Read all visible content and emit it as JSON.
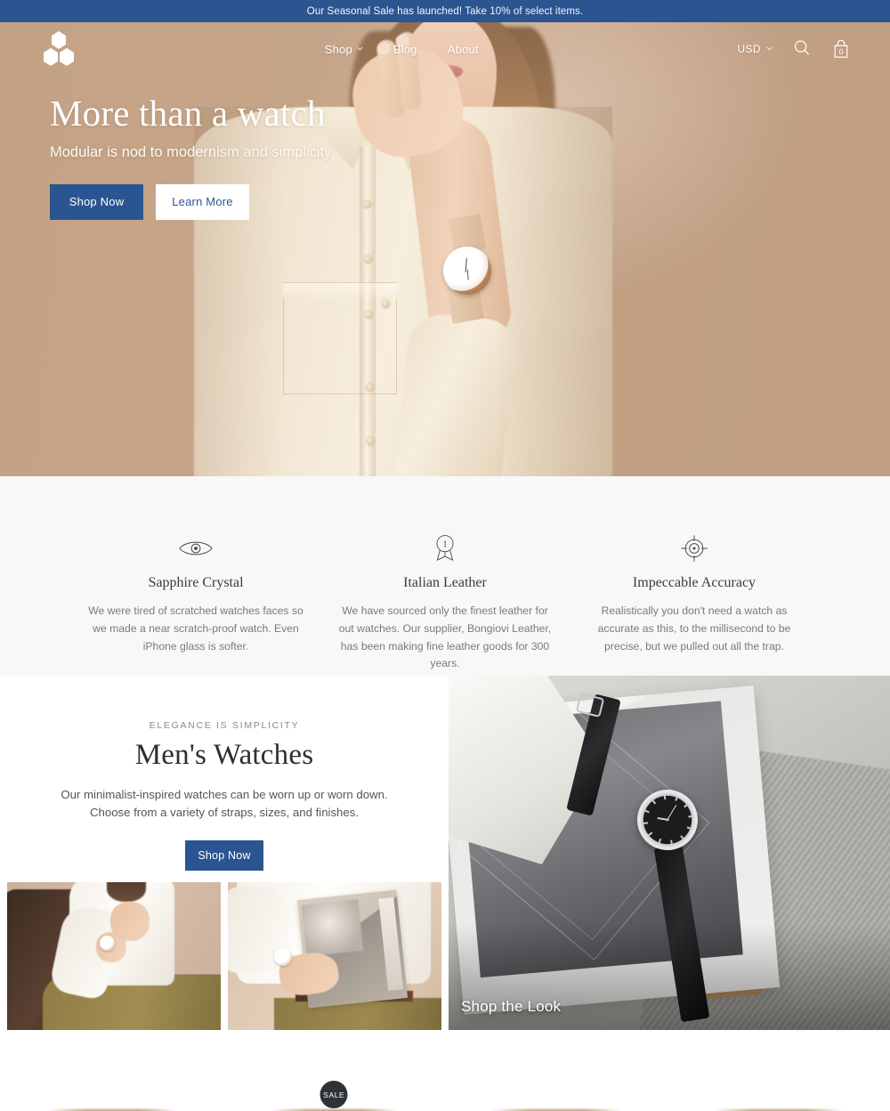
{
  "announcement": {
    "text": "Our Seasonal Sale has launched! Take 10% of select items."
  },
  "header": {
    "logo_name": "modular-hexagon-logo",
    "nav": [
      {
        "label": "Shop",
        "has_dropdown": true
      },
      {
        "label": "Blog",
        "has_dropdown": false
      },
      {
        "label": "About",
        "has_dropdown": false
      }
    ],
    "currency": "USD",
    "search_label": "Search",
    "cart_count": "0"
  },
  "hero": {
    "title": "More than a watch",
    "subtitle": "Modular is nod to modernism and simplicity",
    "primary_button": "Shop Now",
    "secondary_button": "Learn More"
  },
  "features": [
    {
      "icon": "eye-icon",
      "title": "Sapphire Crystal",
      "text": "We were tired of scratched watches faces so we made a near scratch-proof watch. Even iPhone glass is softer."
    },
    {
      "icon": "award-ribbon-icon",
      "icon_number": "1",
      "title": "Italian Leather",
      "text": "We have sourced only the finest leather for out watches. Our supplier, Bongiovi Leather, has been making fine leather goods for 300 years."
    },
    {
      "icon": "crosshair-target-icon",
      "title": "Impeccable Accuracy",
      "text": "Realistically you don't need a watch as accurate as this, to the millisecond to be precise, but we pulled out all the trap."
    }
  ],
  "collection": {
    "eyebrow": "ELEGANCE IS SIMPLICITY",
    "title": "Men's Watches",
    "text_line1": "Our minimalist-inspired watches can be worn up or worn down.",
    "text_line2": "Choose from a variety of straps, sizes, and finishes.",
    "button": "Shop Now",
    "thumb_a_alt": "man-seated-wearing-watch-photo",
    "thumb_b_alt": "man-holding-art-book-wearing-watch-photo",
    "look_label": "Shop the Look",
    "look_alt": "black-leather-watch-on-notebook-photo"
  },
  "products": [
    {
      "name": "product-1",
      "badge": ""
    },
    {
      "name": "product-2",
      "badge": "SALE"
    },
    {
      "name": "product-3",
      "badge": ""
    },
    {
      "name": "product-4",
      "badge": ""
    }
  ],
  "colors": {
    "accent_blue": "#2b5590",
    "hero_bg_tan": "#c2a084",
    "features_bg": "#f8f8f8",
    "badge_dark": "#2f3237"
  }
}
